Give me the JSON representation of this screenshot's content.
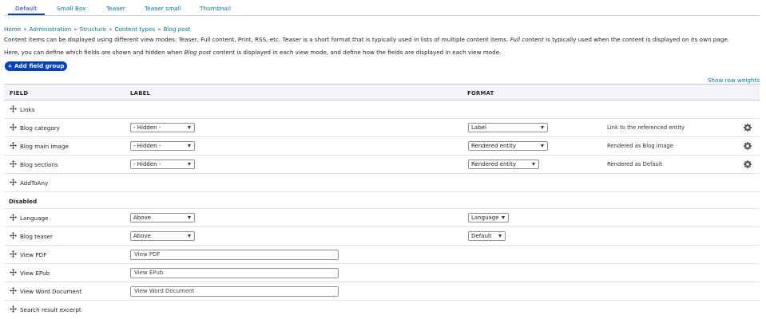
{
  "tabs": [
    {
      "label": "Default",
      "active": true
    },
    {
      "label": "Small Box",
      "active": false
    },
    {
      "label": "Teaser",
      "active": false
    },
    {
      "label": "Teaser small",
      "active": false
    },
    {
      "label": "Thumbnail",
      "active": false
    }
  ],
  "breadcrumb": [
    "Home",
    "Administration",
    "Structure",
    "Content types",
    "Blog post"
  ],
  "breadcrumb_sep": "»",
  "description": {
    "line1_a": "Content items can be displayed using different view modes: Teaser, Full content, Print, RSS, etc. ",
    "line1_em1": "Teaser",
    "line1_b": " is a short format that is typically used in lists of multiple content items. ",
    "line1_em2": "Full content",
    "line1_c": " is typically used when the content is displayed on its own page.",
    "line2_a": "Here, you can define which fields are shown and hidden when ",
    "line2_em": "Blog post",
    "line2_b": " content is displayed in each view mode, and define how the fields are displayed in each view mode."
  },
  "add_field_group": "+ Add field group",
  "show_row_weights": "Show row weights",
  "table": {
    "headers": {
      "field": "FIELD",
      "label": "LABEL",
      "format": "FORMAT"
    },
    "rows": [
      {
        "name": "Links"
      },
      {
        "name": "Blog category",
        "label": "- Hidden -",
        "format": "Label",
        "summary": "Link to the referenced entity"
      },
      {
        "name": "Blog main image",
        "label": "- Hidden -",
        "format": "Rendered entity",
        "summary": "Rendered as Blog image"
      },
      {
        "name": "Blog sections",
        "label": "- Hidden -",
        "format": "Rendered entity",
        "summary": "Rendered as Default"
      },
      {
        "name": "AddToAny"
      }
    ],
    "disabled_region": "Disabled",
    "disabled_rows": [
      {
        "name": "Language",
        "label": "Above",
        "format": "Language"
      },
      {
        "name": "Blog teaser",
        "label": "Above",
        "format": "Default"
      },
      {
        "name": "View PDF",
        "text_value": "View PDF"
      },
      {
        "name": "View EPub",
        "text_value": "View EPub"
      },
      {
        "name": "View Word Document",
        "text_value": "View Word Document"
      },
      {
        "name": "Search result excerpt"
      }
    ]
  },
  "icons": {
    "drag": "drag-handle-icon",
    "settings": "gear-icon"
  },
  "colors": {
    "link": "#0074bd",
    "primary_button": "#003ecc",
    "header_bg": "#f3f4f9"
  }
}
